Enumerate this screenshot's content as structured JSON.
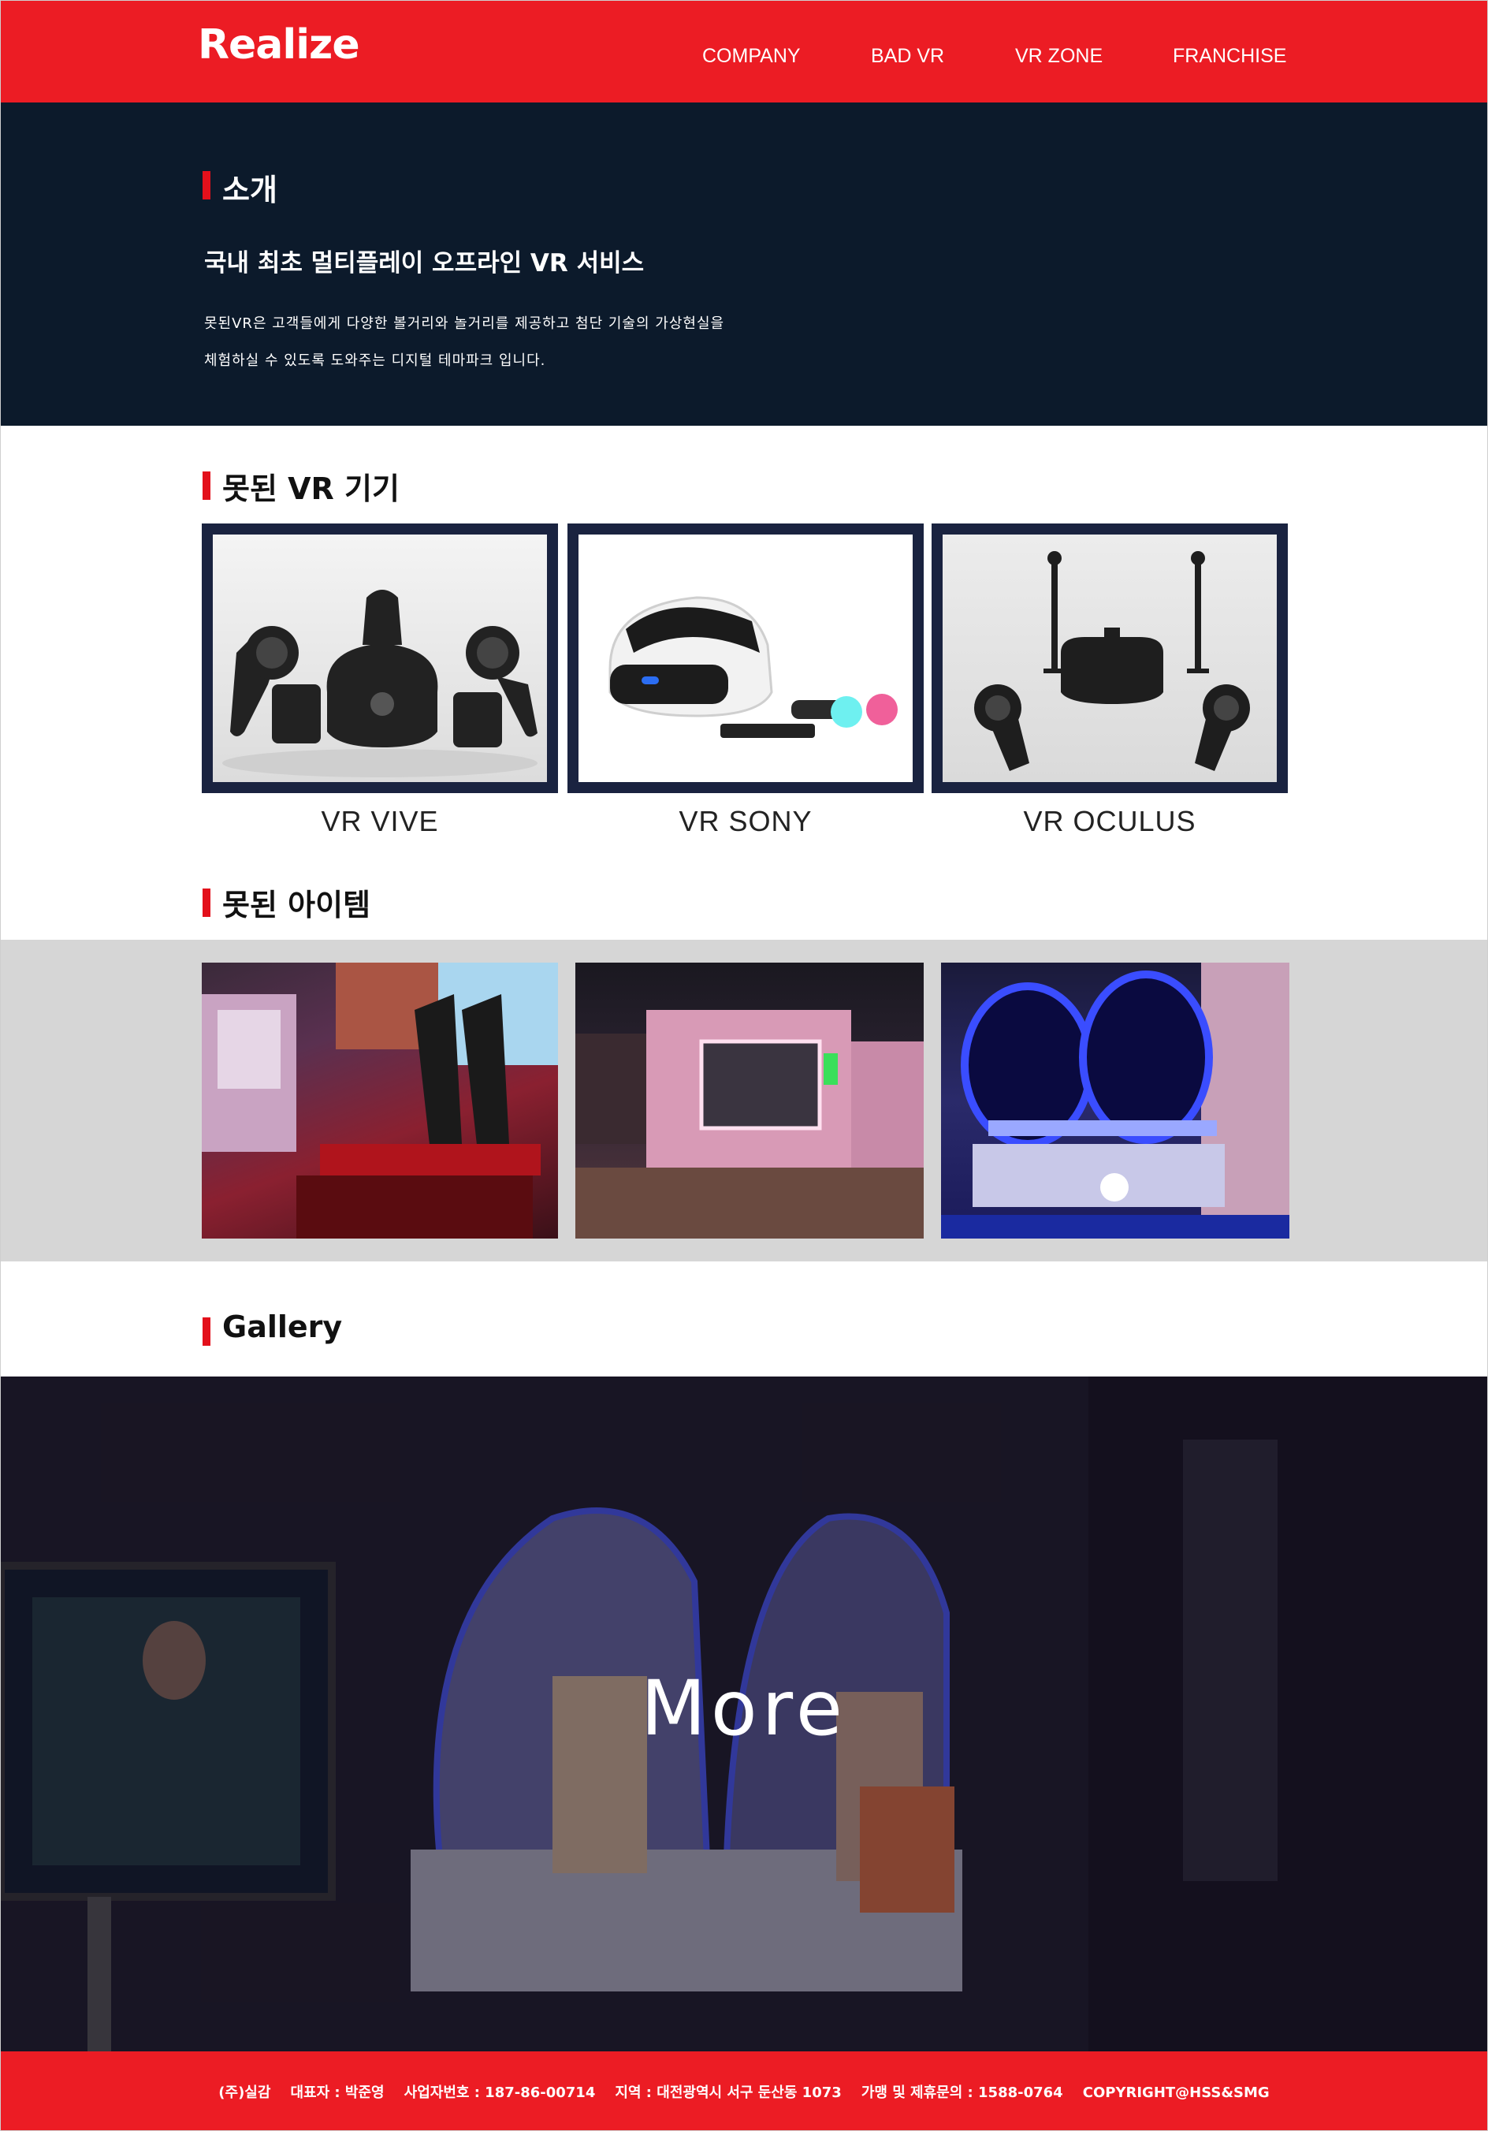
{
  "header": {
    "logo": "Realize",
    "nav": [
      "COMPANY",
      "BAD VR",
      "VR ZONE",
      "FRANCHISE"
    ]
  },
  "intro": {
    "title": "소개",
    "subtitle": "국내 최초 멀티플레이 오프라인 VR 서비스",
    "line1": "못된VR은 고객들에게 다양한 볼거리와 놀거리를 제공하고 첨단 기술의 가상현실을",
    "line2": "체험하실 수 있도록 도와주는 디지털 테마파크 입니다."
  },
  "devices": {
    "title": "못된 VR 기기",
    "items": [
      {
        "label": "VR VIVE"
      },
      {
        "label": "VR SONY"
      },
      {
        "label": "VR OCULUS"
      }
    ]
  },
  "items": {
    "title": "못된 아이템",
    "photos": [
      "racing-seat-photo",
      "vr-booth-photo",
      "egg-chair-photo"
    ]
  },
  "gallery": {
    "title": "Gallery",
    "more": "More"
  },
  "footer": {
    "text": "(주)실감    대표자 : 박준영    사업자번호 : 187-86-00714    지역 : 대전광역시 서구 둔산동 1073    가맹 및 제휴문의 : 1588-0764    COPYRIGHT@HSS&SMG"
  },
  "colors": {
    "brand_red": "#ec1c24",
    "navy": "#0c1a2b",
    "card_frame": "#1a2340",
    "items_band": "#d6d6d6"
  }
}
